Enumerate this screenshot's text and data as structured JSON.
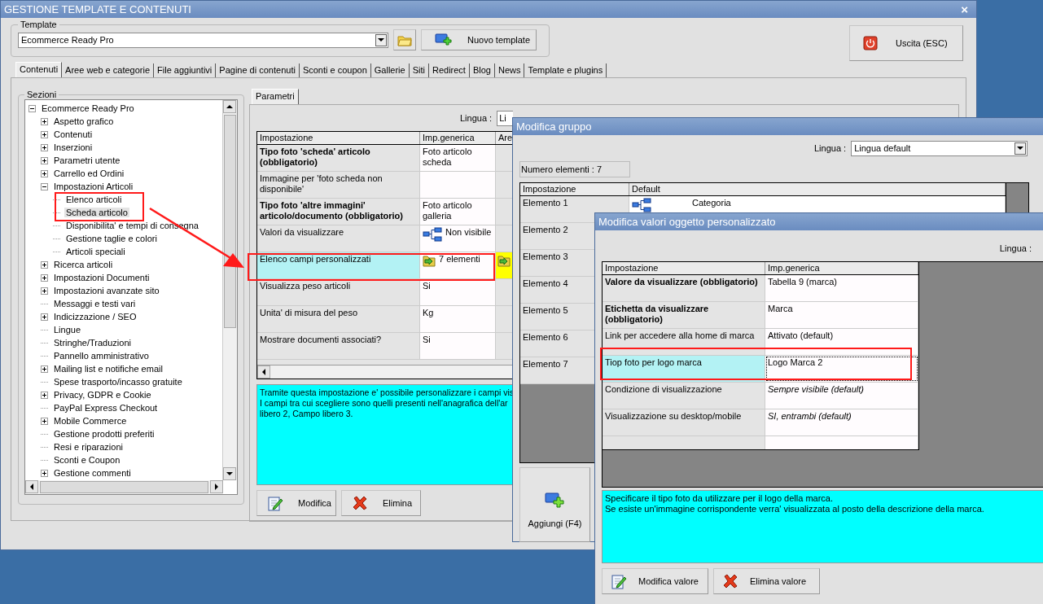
{
  "main_window": {
    "title": "GESTIONE TEMPLATE E CONTENUTI",
    "close": "×",
    "template_group": {
      "label": "Template",
      "value": "Ecommerce Ready Pro"
    },
    "new_template_button": "Nuovo template",
    "exit_button": "Uscita (ESC)",
    "tabs": [
      {
        "label": "Contenuti",
        "selected": true
      },
      {
        "label": "Aree web e categorie",
        "selected": false
      },
      {
        "label": "File aggiuntivi",
        "selected": false
      },
      {
        "label": "Pagine di contenuti",
        "selected": false
      },
      {
        "label": "Sconti e coupon",
        "selected": false
      },
      {
        "label": "Gallerie",
        "selected": false
      },
      {
        "label": "Siti",
        "selected": false
      },
      {
        "label": "Redirect",
        "selected": false
      },
      {
        "label": "Blog",
        "selected": false
      },
      {
        "label": "News",
        "selected": false
      },
      {
        "label": "Template e plugins",
        "selected": false
      }
    ],
    "sections_label": "Sezioni",
    "tree": [
      {
        "label": "Ecommerce Ready Pro",
        "kind": "node",
        "expanded": true,
        "selected": false,
        "children": [
          {
            "label": "Aspetto grafico",
            "kind": "node",
            "expanded": false,
            "selected": false
          },
          {
            "label": "Contenuti",
            "kind": "node",
            "expanded": false,
            "selected": false
          },
          {
            "label": "Inserzioni",
            "kind": "node",
            "expanded": false,
            "selected": false
          },
          {
            "label": "Parametri utente",
            "kind": "node",
            "expanded": false,
            "selected": false
          },
          {
            "label": "Carrello ed Ordini",
            "kind": "node",
            "expanded": false,
            "selected": false
          },
          {
            "label": "Impostazioni Articoli",
            "kind": "node",
            "expanded": true,
            "selected": false,
            "children": [
              {
                "label": "Elenco articoli",
                "kind": "leaf",
                "selected": false
              },
              {
                "label": "Scheda articolo",
                "kind": "leaf",
                "selected": true
              },
              {
                "label": "Disponibilita' e tempi di consegna",
                "kind": "leaf",
                "selected": false
              },
              {
                "label": "Gestione taglie e colori",
                "kind": "leaf",
                "selected": false
              },
              {
                "label": "Articoli speciali",
                "kind": "leaf",
                "selected": false
              }
            ]
          },
          {
            "label": "Ricerca articoli",
            "kind": "node",
            "expanded": false,
            "selected": false
          },
          {
            "label": "Impostazioni Documenti",
            "kind": "node",
            "expanded": false,
            "selected": false
          },
          {
            "label": "Impostazioni avanzate sito",
            "kind": "node",
            "expanded": false,
            "selected": false
          },
          {
            "label": "Messaggi e testi vari",
            "kind": "leaf",
            "selected": false
          },
          {
            "label": "Indicizzazione / SEO",
            "kind": "node",
            "expanded": false,
            "selected": false
          },
          {
            "label": "Lingue",
            "kind": "leaf",
            "selected": false
          },
          {
            "label": "Stringhe/Traduzioni",
            "kind": "leaf",
            "selected": false
          },
          {
            "label": "Pannello amministrativo",
            "kind": "leaf",
            "selected": false
          },
          {
            "label": "Mailing list e notifiche email",
            "kind": "node",
            "expanded": false,
            "selected": false
          },
          {
            "label": "Spese trasporto/incasso gratuite",
            "kind": "leaf",
            "selected": false
          },
          {
            "label": "Privacy, GDPR e Cookie",
            "kind": "node",
            "expanded": false,
            "selected": false
          },
          {
            "label": "PayPal Express Checkout",
            "kind": "leaf",
            "selected": false
          },
          {
            "label": "Mobile Commerce",
            "kind": "node",
            "expanded": false,
            "selected": false
          },
          {
            "label": "Gestione prodotti preferiti",
            "kind": "leaf",
            "selected": false
          },
          {
            "label": "Resi e riparazioni",
            "kind": "leaf",
            "selected": false
          },
          {
            "label": "Sconti e Coupon",
            "kind": "leaf",
            "selected": false
          },
          {
            "label": "Gestione commenti",
            "kind": "node",
            "expanded": false,
            "selected": false
          }
        ]
      }
    ],
    "subtabs": [
      {
        "label": "Parametri",
        "selected": true
      }
    ],
    "lingua_label": "Lingua :",
    "lingua_value": "Li",
    "table": {
      "columns": [
        "Impostazione",
        "Imp.generica",
        "Are"
      ],
      "rows": [
        {
          "setting": "Tipo foto 'scheda' articolo (obbligatorio)",
          "required": true,
          "value": "Foto articolo scheda",
          "kind": "plain",
          "selected": false,
          "area_marked": false
        },
        {
          "setting": "Immagine per 'foto scheda non disponibile'",
          "required": false,
          "value": "",
          "kind": "plain",
          "selected": false,
          "area_marked": false
        },
        {
          "setting": "Tipo foto 'altre immagini' articolo/documento (obbligatorio)",
          "required": true,
          "value": "Foto articolo galleria",
          "kind": "plain",
          "selected": false,
          "area_marked": false
        },
        {
          "setting": "Valori da visualizzare",
          "required": false,
          "value": "Non visibile",
          "kind": "tree",
          "selected": false,
          "area_marked": false
        },
        {
          "setting": "Elenco campi personalizzati",
          "required": false,
          "value": "7 elementi",
          "kind": "folder",
          "selected": true,
          "area_marked": true
        },
        {
          "setting": "Visualizza peso articoli",
          "required": false,
          "value": "Si",
          "kind": "plain",
          "selected": false,
          "area_marked": false
        },
        {
          "setting": "Unita' di misura del peso",
          "required": false,
          "value": "Kg",
          "kind": "plain",
          "selected": false,
          "area_marked": false
        },
        {
          "setting": "Mostrare documenti associati?",
          "required": false,
          "value": "Si",
          "kind": "plain",
          "selected": false,
          "area_marked": false
        }
      ]
    },
    "description": [
      "Tramite questa impostazione e' possibile personalizzare i campi vis",
      "I campi tra cui scegliere sono quelli presenti nell'anagrafica dell'ar",
      "libero 2, Campo libero 3."
    ],
    "actions": [
      "Modifica",
      "Elimina"
    ]
  },
  "group_window": {
    "title": "Modifica gruppo",
    "lingua_label": "Lingua :",
    "lingua_value": "Lingua default",
    "count": "Numero elementi : 7",
    "columns": [
      "Impostazione",
      "Default"
    ],
    "rows": [
      {
        "setting": "Elemento 1",
        "value": "Categoria"
      },
      {
        "setting": "Elemento 2"
      },
      {
        "setting": "Elemento 3"
      },
      {
        "setting": "Elemento 4"
      },
      {
        "setting": "Elemento 5"
      },
      {
        "setting": "Elemento 6"
      },
      {
        "setting": "Elemento 7"
      }
    ],
    "add_button": "Aggiungi (F4)"
  },
  "values_window": {
    "title": "Modifica valori oggetto personalizzato",
    "lingua_label": "Lingua :",
    "columns": [
      "Impostazione",
      "Imp.generica"
    ],
    "rows": [
      {
        "setting": "Valore da visualizzare (obbligatorio)",
        "required": true,
        "value": "Tabella 9 (marca)",
        "italic": false,
        "selected": false
      },
      {
        "setting": "Etichetta da visualizzare (obbligatorio)",
        "required": true,
        "value": "Marca",
        "italic": false,
        "selected": false
      },
      {
        "setting": "Link per accedere alla home di marca",
        "required": false,
        "value": "Attivato (default)",
        "italic": false,
        "selected": false
      },
      {
        "setting": "Tiop foto per logo marca",
        "required": false,
        "value": "Logo Marca 2",
        "italic": false,
        "selected": true
      },
      {
        "setting": "Condizione di visualizzazione",
        "required": false,
        "value": "Sempre visibile (default)",
        "italic": true,
        "selected": false
      },
      {
        "setting": "Visualizzazione su desktop/mobile",
        "required": false,
        "value": "SI, entrambi (default)",
        "italic": true,
        "selected": false
      }
    ],
    "description": [
      "Specificare il tipo foto da utilizzare per il logo della marca.",
      "Se esiste un'immagine corrispondente verra' visualizzata al posto della descrizione della marca."
    ],
    "actions": [
      "Modifica valore",
      "Elimina valore"
    ]
  }
}
